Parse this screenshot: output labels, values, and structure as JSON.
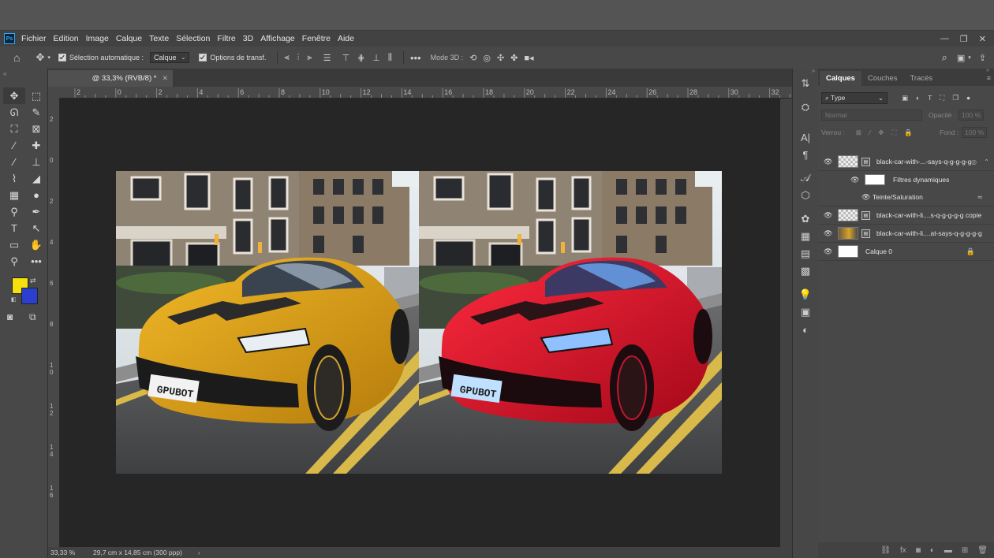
{
  "app": {
    "logo": "Ps"
  },
  "menu": [
    "Fichier",
    "Edition",
    "Image",
    "Calque",
    "Texte",
    "Sélection",
    "Filtre",
    "3D",
    "Affichage",
    "Fenêtre",
    "Aide"
  ],
  "options": {
    "auto_select_label": "Sélection automatique :",
    "auto_select_value": "Calque",
    "transform_label": "Options de transf.",
    "mode3d_label": "Mode 3D :"
  },
  "document": {
    "tab_label": "@ 33,3% (RVB/8) *",
    "zoom": "33,33 %",
    "doc_info": "29,7 cm x 14,85 cm (300 ppp)"
  },
  "rulers": {
    "horizontal": [
      "2",
      "0",
      "2",
      "4",
      "6",
      "8",
      "10",
      "12",
      "14",
      "16",
      "18",
      "20",
      "22",
      "24",
      "26",
      "28",
      "30",
      "32"
    ],
    "vertical": [
      "2",
      "0",
      "2",
      "4",
      "6",
      "8",
      "1 0",
      "1 2",
      "1 4",
      "1 6"
    ]
  },
  "license_plate": "GPUBOT",
  "panel": {
    "tabs": [
      "Calques",
      "Couches",
      "Tracés"
    ],
    "filter_type": "Type",
    "blend_mode": "Normal",
    "opacity_label": "Opacité :",
    "opacity_value": "100 %",
    "lock_label": "Verrou :",
    "fill_label": "Fond :",
    "fill_value": "100 %",
    "layers": [
      {
        "name": "black-car-with-...-says-q-g-g-g-g"
      },
      {
        "name": "Filtres dynamiques"
      },
      {
        "name": "Teinte/Saturation"
      },
      {
        "name": "black-car-with-li....s-q-g-g-g-g copie"
      },
      {
        "name": "black-car-with-li....at-says-q-g-g-g-g"
      },
      {
        "name": "Calque 0"
      }
    ]
  },
  "colors": {
    "foreground": "#f5df0c",
    "background": "#2b3fcf",
    "car_left": "#e3a51a",
    "car_right": "#e0112a"
  }
}
